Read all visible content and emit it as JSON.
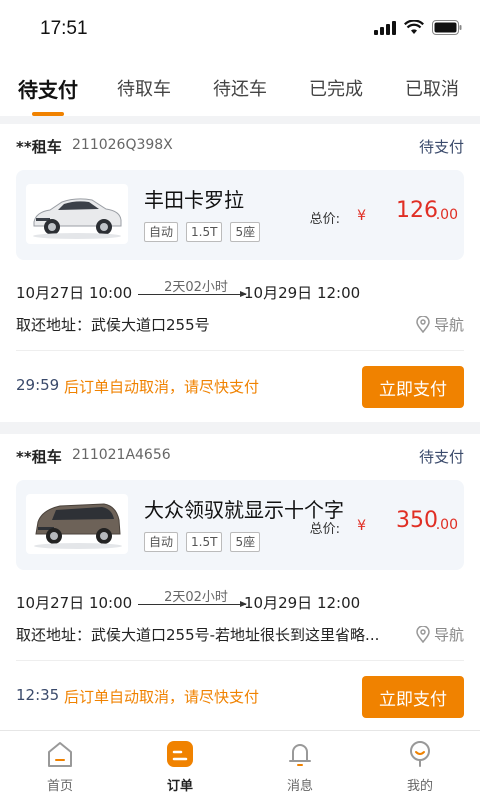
{
  "status_bar": {
    "time": "17:51"
  },
  "tabs": [
    {
      "label": "待支付",
      "active": true
    },
    {
      "label": "待取车",
      "active": false
    },
    {
      "label": "待还车",
      "active": false
    },
    {
      "label": "已完成",
      "active": false
    },
    {
      "label": "已取消",
      "active": false
    }
  ],
  "orders": [
    {
      "type": "**租车",
      "order_no": "211026Q398X",
      "status": "待支付",
      "car_name": "丰田卡罗拉",
      "tags": [
        "自动",
        "1.5T",
        "5座"
      ],
      "price_label": "总价:",
      "price_currency": "¥",
      "price_int": "126",
      "price_dec": ".00",
      "pickup_time": "10月27日 10:00",
      "duration": "2天02小时",
      "return_time": "10月29日 12:00",
      "address": "取还地址：武侯大道口255号",
      "nav_label": "导航",
      "countdown": "29:59",
      "pay_hint": "后订单自动取消，请尽快支付",
      "pay_button": "立即支付"
    },
    {
      "type": "**租车",
      "order_no": "211021A4656",
      "status": "待支付",
      "car_name": "大众领驭就显示十个字",
      "tags": [
        "自动",
        "1.5T",
        "5座"
      ],
      "price_label": "总价:",
      "price_currency": "¥",
      "price_int": "350",
      "price_dec": ".00",
      "pickup_time": "10月27日 10:00",
      "duration": "2天02小时",
      "return_time": "10月29日 12:00",
      "address": "取还地址：武侯大道口255号-若地址很长到这里省略...",
      "nav_label": "导航",
      "countdown": "12:35",
      "pay_hint": "后订单自动取消，请尽快支付",
      "pay_button": "立即支付"
    }
  ],
  "bottom_nav": [
    {
      "label": "首页",
      "icon": "home-icon",
      "active": false
    },
    {
      "label": "订单",
      "icon": "order-icon",
      "active": true
    },
    {
      "label": "消息",
      "icon": "bell-icon",
      "active": false
    },
    {
      "label": "我的",
      "icon": "profile-icon",
      "active": false
    }
  ],
  "colors": {
    "accent": "#f08200",
    "price": "#e02e24",
    "status_text": "#3a4a6b",
    "card_bg": "#f3f6fa",
    "page_bg": "#f2f3f5"
  }
}
